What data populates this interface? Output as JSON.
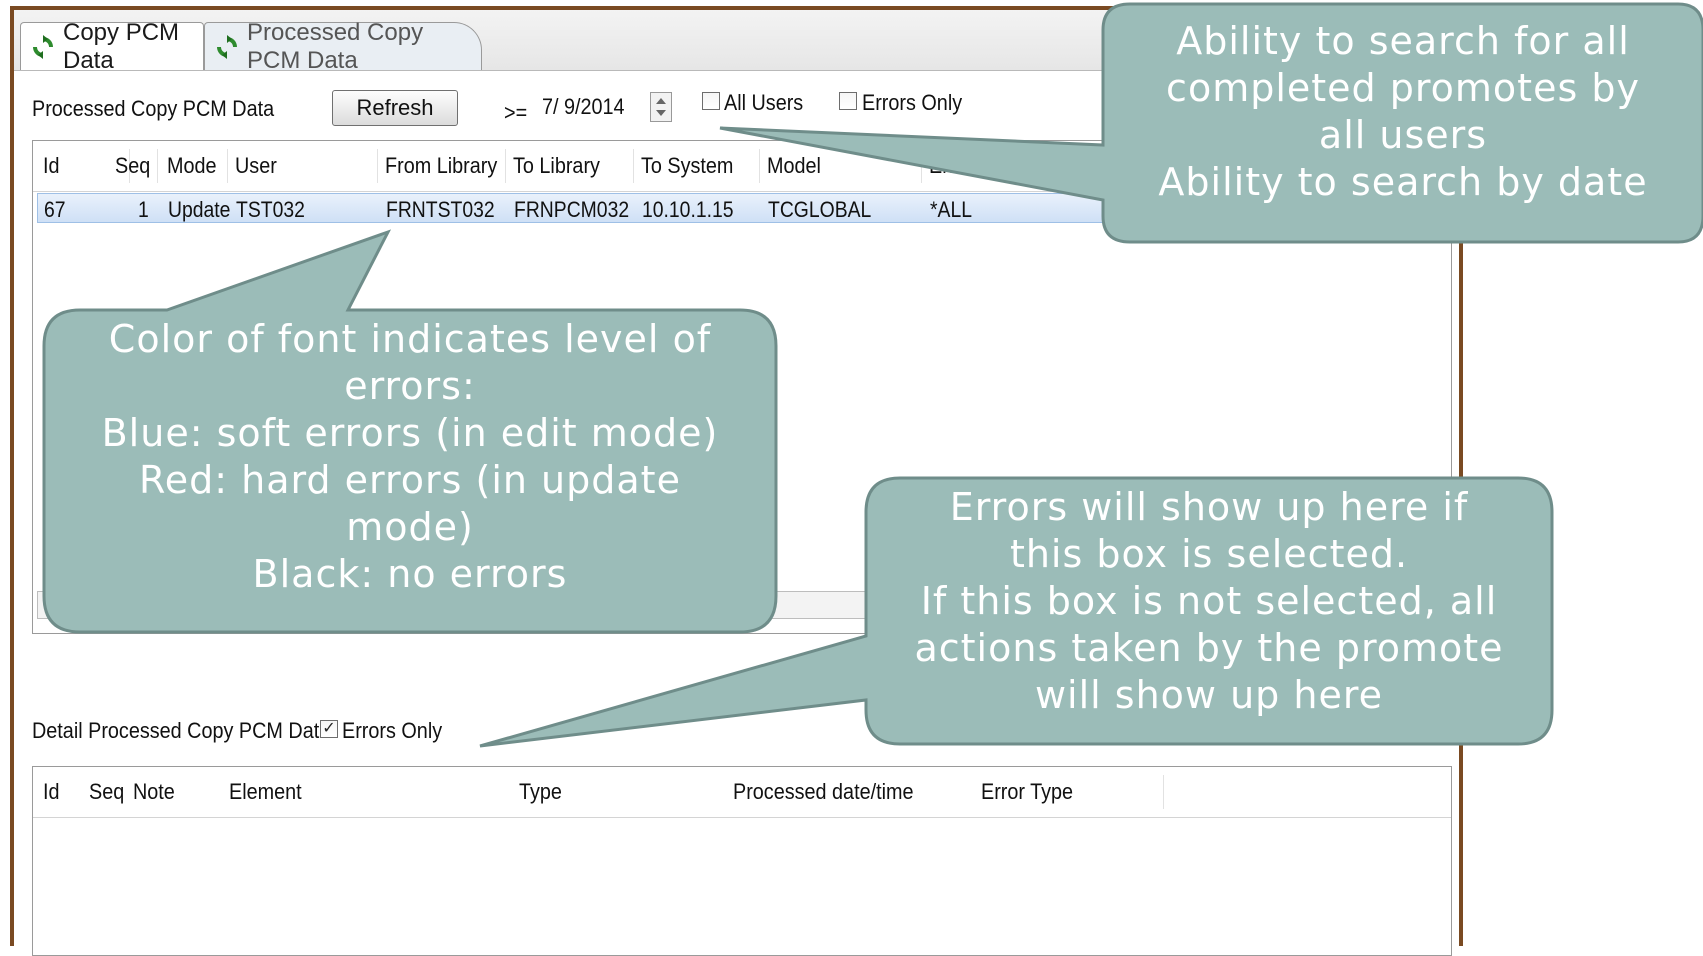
{
  "tabs": [
    {
      "label": "Copy PCM Data",
      "icon": "refresh-green-icon"
    },
    {
      "label": "Processed Copy PCM Data",
      "icon": "refresh-green-icon"
    }
  ],
  "top_panel": {
    "title": "Processed Copy PCM Data",
    "refresh_label": "Refresh",
    "operator": ">=",
    "date_value": "7/ 9/2014",
    "all_users_label": "All Users",
    "all_users_checked": false,
    "errors_only_label": "Errors Only",
    "errors_only_checked": false
  },
  "main_table": {
    "columns": [
      "Id",
      "Seq",
      "Mode",
      "User",
      "From Library",
      "To Library",
      "To System",
      "Model",
      "Eleme"
    ],
    "rows": [
      [
        "67",
        "1",
        "Update",
        "TST032",
        "FRNTST032",
        "FRNPCM032",
        "10.10.1.15",
        "TCGLOBAL",
        "*ALL"
      ]
    ]
  },
  "detail_panel": {
    "title": "Detail Processed Copy PCM Data",
    "errors_only_label": "Errors Only",
    "errors_only_checked": true,
    "check_mark": "✓",
    "columns": [
      "Id",
      "Seq",
      "Note",
      "Element",
      "Type",
      "Processed date/time",
      "Error Type"
    ]
  },
  "callouts": {
    "top_right": [
      "Ability to search for all",
      "completed promotes by",
      "all users",
      "Ability to search by date"
    ],
    "left": [
      "Color of font indicates level of",
      "errors:",
      "Blue: soft errors (in edit mode)",
      "Red: hard errors (in update",
      "mode)",
      "Black: no errors"
    ],
    "bottom_right": [
      "Errors will show up here if",
      "this box is selected.",
      "If this box is not selected, all",
      "actions taken by the promote",
      "will show up here"
    ]
  },
  "colors": {
    "callout_fill": "#9bbcb8",
    "callout_border": "#6f8d8a",
    "frame_border": "#7a4a22",
    "selected_row": "#cfe0f6"
  }
}
